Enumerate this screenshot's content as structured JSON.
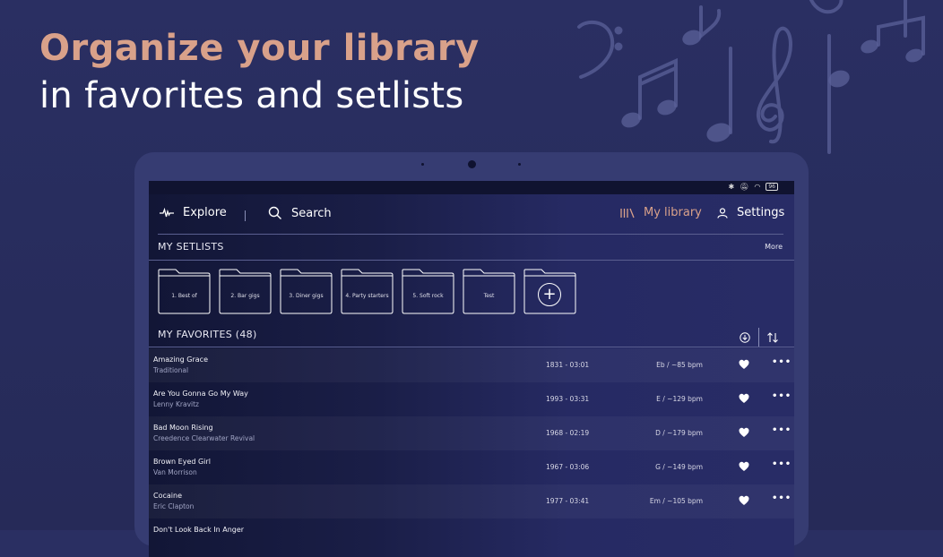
{
  "headline": {
    "line1": "Organize your library",
    "line2": "in favorites and setlists"
  },
  "colors": {
    "accent": "#d9a18a",
    "background": "#272c5c",
    "tablet_frame": "#363c72"
  },
  "statusbar": {
    "battery": "96"
  },
  "nav": {
    "explore": "Explore",
    "search": "Search",
    "my_library": "My library",
    "settings": "Settings",
    "icons": {
      "explore": "waveform-icon",
      "search": "search-icon",
      "my_library": "library-icon",
      "settings": "user-icon"
    }
  },
  "setlists": {
    "title": "MY SETLISTS",
    "more": "More",
    "folders": [
      {
        "name": "1. Best of"
      },
      {
        "name": "2. Bar gigs"
      },
      {
        "name": "3. Diner gigs"
      },
      {
        "name": "4. Party starters"
      },
      {
        "name": "5. Soft rock"
      },
      {
        "name": "Test"
      }
    ],
    "add_icon": "plus-circle-icon"
  },
  "favorites": {
    "title": "MY FAVORITES (48)",
    "icons": {
      "download": "download-icon",
      "sort": "sort-icon"
    },
    "rows": [
      {
        "title": "Amazing Grace",
        "artist": "Traditional",
        "year_duration": "1831 - 03:01",
        "key_tempo": "Eb / ~85 bpm"
      },
      {
        "title": "Are You Gonna Go My Way",
        "artist": "Lenny Kravitz",
        "year_duration": "1993 - 03:31",
        "key_tempo": "E / ~129 bpm"
      },
      {
        "title": "Bad Moon Rising",
        "artist": "Creedence Clearwater Revival",
        "year_duration": "1968 - 02:19",
        "key_tempo": "D / ~179 bpm"
      },
      {
        "title": "Brown Eyed Girl",
        "artist": "Van Morrison",
        "year_duration": "1967 - 03:06",
        "key_tempo": "G / ~149 bpm"
      },
      {
        "title": "Cocaine",
        "artist": "Eric Clapton",
        "year_duration": "1977 - 03:41",
        "key_tempo": "Em / ~105 bpm"
      },
      {
        "title": "Don't Look Back In Anger",
        "artist": "",
        "year_duration": "",
        "key_tempo": ""
      }
    ],
    "row_icons": {
      "heart": "heart-icon",
      "more": "more-dots-icon"
    },
    "more_glyph": "•••"
  }
}
